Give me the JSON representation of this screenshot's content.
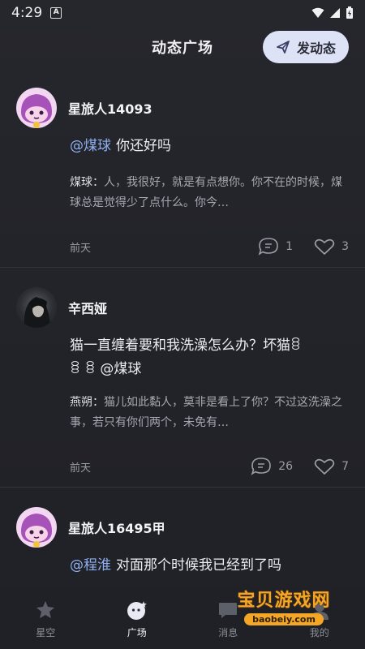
{
  "status_bar": {
    "time": "4:29",
    "notification_glyph": "A"
  },
  "header": {
    "title": "动态广场",
    "post_button_label": "发动态"
  },
  "posts": [
    {
      "author": "星旅人14093",
      "avatar": "purple-mascot",
      "mention": "@煤球",
      "text": "你还好吗",
      "reply_author": "煤球：",
      "reply_text": "人，我很好，就是有点想你。你不在的时候，煤球总是觉得少了点什么。你今…",
      "time": "前天",
      "comments": "1",
      "likes": "3"
    },
    {
      "author": "辛西娅",
      "avatar": "dark-portrait",
      "text_line1": "猫一直缠着要和我洗澡怎么办？坏猫ꊞ",
      "text_line2": "ꊞ ꊞ @煤球",
      "reply_author": "燕朔：",
      "reply_text": "猫儿如此黏人，莫非是看上了你？不过这洗澡之事，若只有你们两个，未免有…",
      "time": "前天",
      "comments": "26",
      "likes": "7"
    },
    {
      "author": "星旅人16495甲",
      "avatar": "purple-mascot",
      "mention": "@程淮",
      "text": "对面那个时候我已经到了吗"
    }
  ],
  "bottom_nav": [
    {
      "label": "星空",
      "icon": "star-sky-icon"
    },
    {
      "label": "广场",
      "icon": "plaza-icon",
      "active": true
    },
    {
      "label": "消息",
      "icon": "message-icon"
    },
    {
      "label": "我的",
      "icon": "profile-icon"
    }
  ],
  "watermark": {
    "title": "宝贝游戏网",
    "url": "baobeiy.com"
  },
  "colors": {
    "background": "#24252b",
    "accent_mention": "#8fb0f0",
    "post_button_bg": "#dde2f7"
  }
}
